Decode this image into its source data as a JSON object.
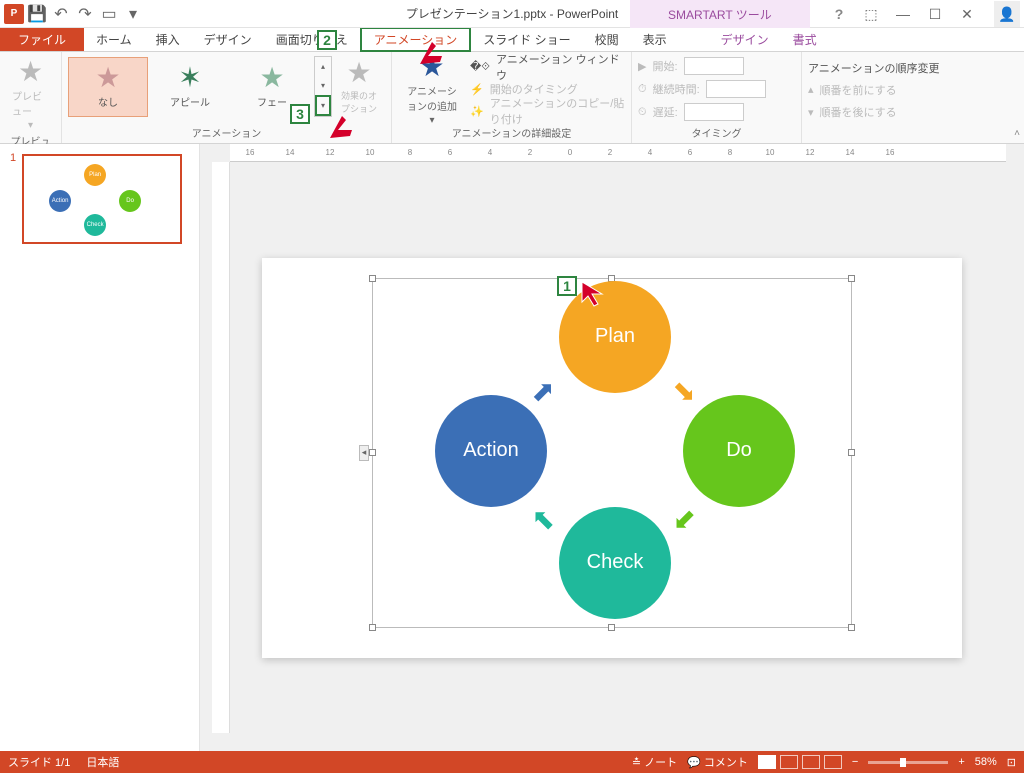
{
  "titlebar": {
    "title": "プレゼンテーション1.pptx - PowerPoint",
    "tool_tab": "SMARTART ツール"
  },
  "tabs": {
    "file": "ファイル",
    "home": "ホーム",
    "insert": "挿入",
    "design": "デザイン",
    "transitions": "画面切り替え",
    "animations": "アニメーション",
    "slideshow": "スライド ショー",
    "review": "校閲",
    "view": "表示",
    "ctx_design": "デザイン",
    "ctx_format": "書式"
  },
  "ribbon": {
    "preview_btn": "プレビュー",
    "preview_group": "プレビュー",
    "gallery": {
      "none": "なし",
      "appeal": "アピール",
      "fade": "フェー"
    },
    "effect_options": "効果のオプション",
    "animation_group": "アニメーション",
    "add_animation": "アニメーションの追加",
    "anim_pane": "アニメーション ウィンドウ",
    "trigger": "開始のタイミング",
    "painter": "アニメーションのコピー/貼り付け",
    "adv_group": "アニメーションの詳細設定",
    "start_label": "開始:",
    "duration_label": "継続時間:",
    "delay_label": "遅延:",
    "timing_group": "タイミング",
    "reorder_title": "アニメーションの順序変更",
    "move_earlier": "順番を前にする",
    "move_later": "順番を後にする"
  },
  "ruler": [
    "16",
    "14",
    "12",
    "10",
    "8",
    "6",
    "4",
    "2",
    "0",
    "2",
    "4",
    "6",
    "8",
    "10",
    "12",
    "14",
    "16"
  ],
  "callouts": {
    "c1": "1",
    "c2": "2",
    "c3": "3"
  },
  "slide": {
    "number": "1",
    "pdca": {
      "plan": "Plan",
      "do": "Do",
      "check": "Check",
      "action": "Action"
    }
  },
  "statusbar": {
    "slide_info": "スライド 1/1",
    "lang": "日本語",
    "notes": "ノート",
    "comments": "コメント",
    "zoom": "58%"
  }
}
